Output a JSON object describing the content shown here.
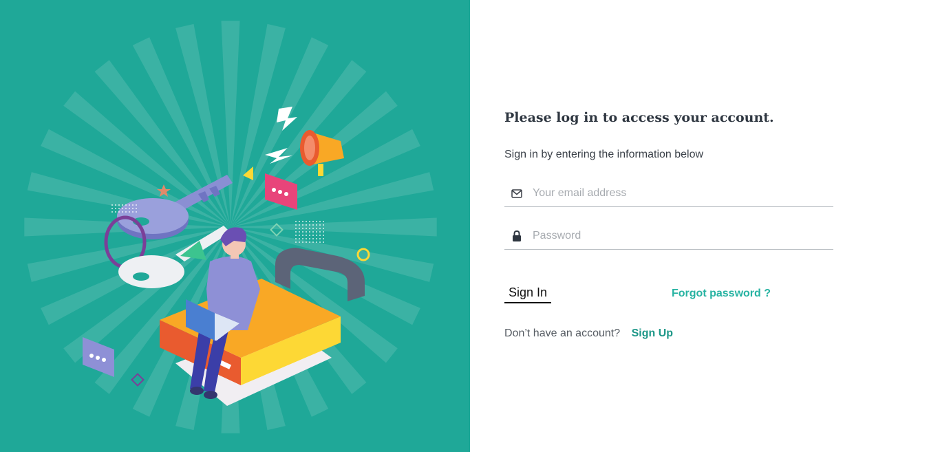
{
  "login": {
    "heading": "Please log in to access your account.",
    "subheading": "Sign in by entering the information below",
    "email": {
      "placeholder": "Your email address",
      "value": "",
      "icon": "envelope-icon"
    },
    "password": {
      "placeholder": "Password",
      "value": "",
      "icon": "lock-icon"
    },
    "signin_label": "Sign In",
    "forgot_label": "Forgot password ?",
    "signup_prompt": "Don’t have an account?",
    "signup_label": "Sign Up"
  },
  "colors": {
    "panel_bg": "#1fa898",
    "accent": "#27b3a2",
    "heading": "#2e3640"
  }
}
